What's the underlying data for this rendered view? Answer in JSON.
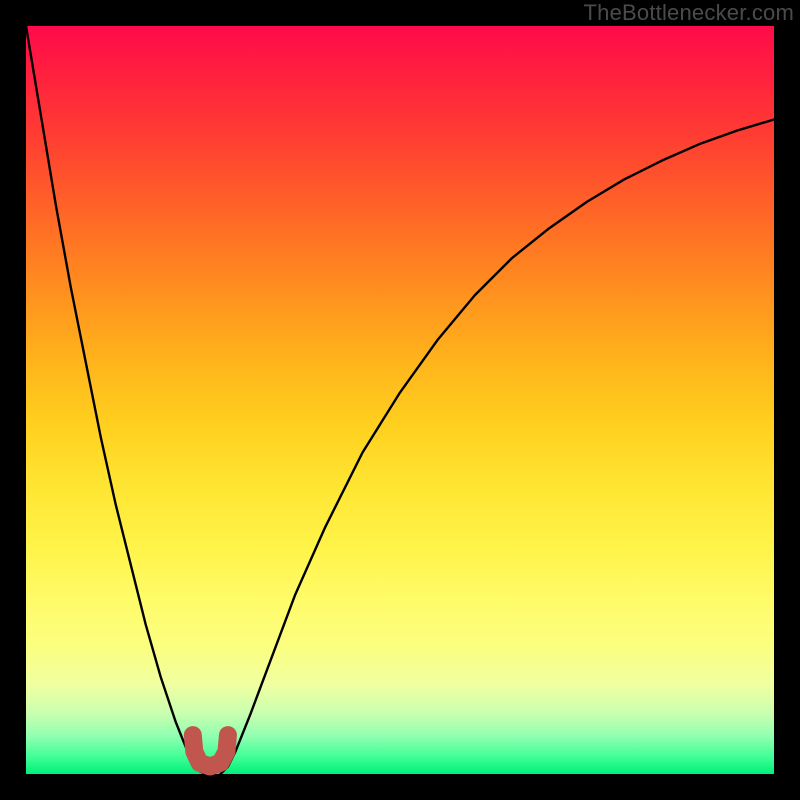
{
  "watermark": {
    "text": "TheBottlenecker.com"
  },
  "chart_data": {
    "type": "line",
    "title": "",
    "xlabel": "",
    "ylabel": "",
    "xlim": [
      0,
      100
    ],
    "ylim": [
      0,
      100
    ],
    "series": [
      {
        "name": "left-curve",
        "x": [
          0,
          2,
          4,
          6,
          8,
          10,
          12,
          14,
          16,
          18,
          20,
          22,
          23,
          24
        ],
        "y": [
          100,
          88,
          76,
          65,
          55,
          45,
          36,
          28,
          20,
          13,
          7,
          2,
          0.5,
          0
        ]
      },
      {
        "name": "right-curve",
        "x": [
          26,
          27,
          28,
          30,
          33,
          36,
          40,
          45,
          50,
          55,
          60,
          65,
          70,
          75,
          80,
          85,
          90,
          95,
          100
        ],
        "y": [
          0,
          1,
          3,
          8,
          16,
          24,
          33,
          43,
          51,
          58,
          64,
          69,
          73,
          76.5,
          79.5,
          82,
          84.2,
          86,
          87.5
        ]
      }
    ],
    "marker": {
      "name": "u-marker",
      "color": "#c1564f",
      "points_xy": [
        [
          22.3,
          5.2
        ],
        [
          22.5,
          3.0
        ],
        [
          23.2,
          1.5
        ],
        [
          24.6,
          1.0
        ],
        [
          26.0,
          1.5
        ],
        [
          26.8,
          3.0
        ],
        [
          27.0,
          5.2
        ]
      ]
    }
  }
}
